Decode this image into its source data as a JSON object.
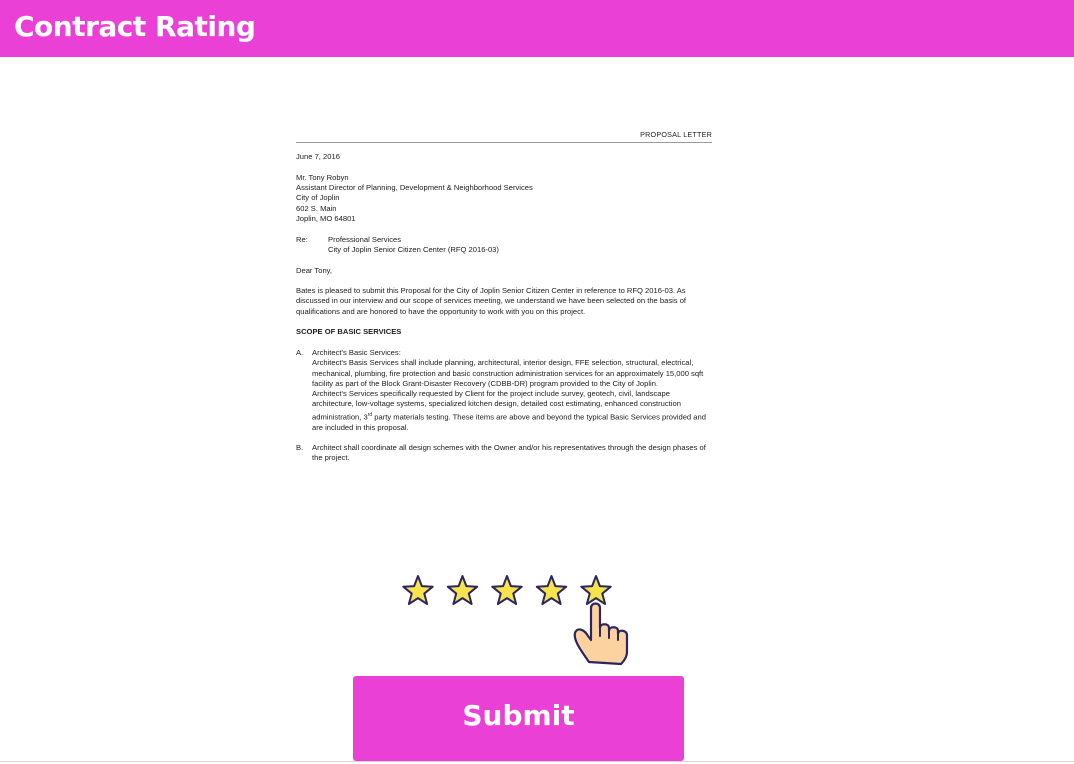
{
  "header": {
    "title": "Contract Rating"
  },
  "letter": {
    "label": "PROPOSAL LETTER",
    "date": "June 7, 2016",
    "recipient": [
      "Mr. Tony Robyn",
      "Assistant Director of Planning, Development & Neighborhood Services",
      "City of Joplin",
      "602 S. Main",
      "Joplin, MO 64801"
    ],
    "re_label": "Re:",
    "re_lines": [
      "Professional Services",
      "City of Joplin Senior Citizen Center (RFQ 2016-03)"
    ],
    "salutation": "Dear Tony,",
    "intro": "Bates is pleased to submit this Proposal for the City of Joplin Senior Citizen Center in reference to RFQ 2016-03.  As discussed in our interview and our scope of services meeting, we understand we have been selected on the basis of qualifications and are honored to have the opportunity to work with you on this project.",
    "scope_heading": "SCOPE OF BASIC SERVICES",
    "item_a": {
      "marker": "A.",
      "title": "Architect's Basic Services:",
      "para1": "Architect's Basis Services shall include planning, architectural, interior design, FFE selection, structural, electrical, mechanical, plumbing, fire protection and basic construction administration services for an approximately 15,000 sqft facility as part of the Block Grant-Disaster Recovery (CDBB-DR) program provided to the City of Joplin.",
      "para2_pre": "Architect's Services specifically requested by Client for the project include survey, geotech, civil, landscape architecture, low-voltage systems, specialized kitchen design, detailed cost estimating, enhanced construction administration, 3",
      "para2_sup": "rd",
      "para2_post": " party materials testing.  These items are above and beyond the typical Basic Services provided and are included in this proposal."
    },
    "item_b": {
      "marker": "B.",
      "text": "Architect shall coordinate all design schemes with the Owner and/or his representatives through the design phases of the project."
    }
  },
  "rating": {
    "value": 5,
    "max": 5,
    "star_color": "#f7e34c",
    "outline_color": "#2b2560"
  },
  "hand_icon": "pointing-hand-icon",
  "submit": {
    "label": "Submit",
    "color": "#ea40d6"
  }
}
